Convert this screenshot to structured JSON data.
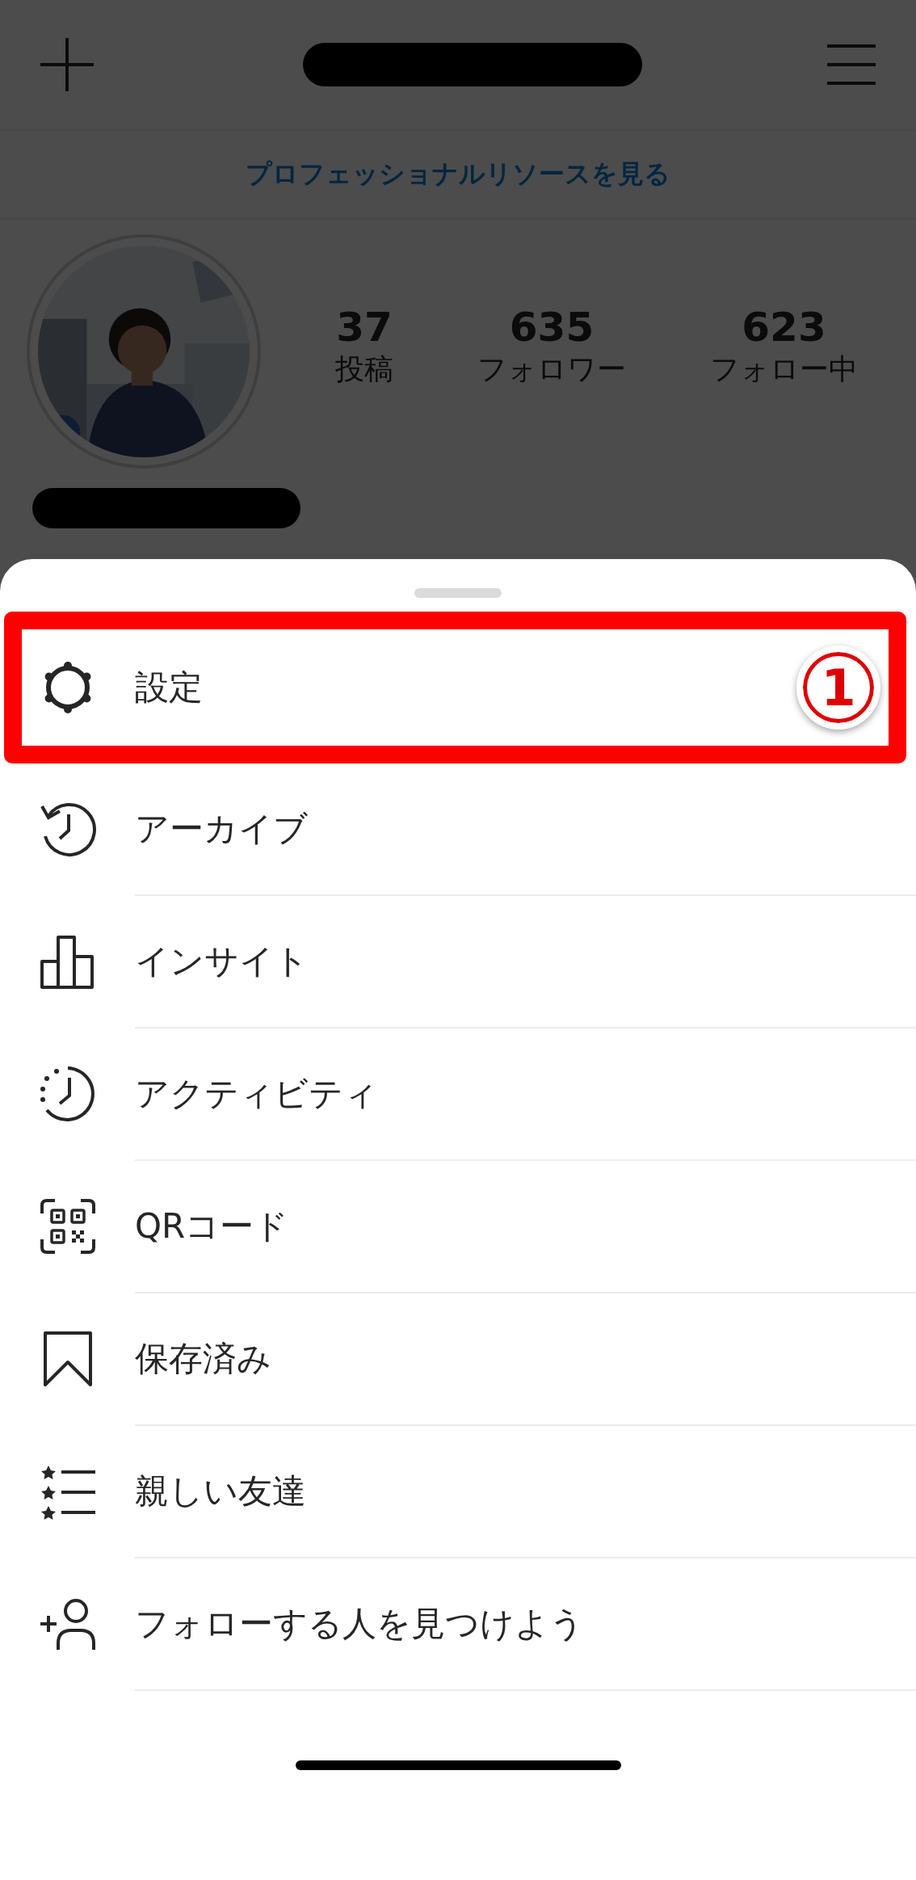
{
  "banner": {
    "link": "プロフェッショナルリソースを見る"
  },
  "profile": {
    "stats": [
      {
        "value": "37",
        "label": "投稿"
      },
      {
        "value": "635",
        "label": "フォロワー"
      },
      {
        "value": "623",
        "label": "フォロー中"
      }
    ]
  },
  "menu": {
    "items": [
      {
        "kind": "gear",
        "label": "設定",
        "highlighted": true,
        "callout": "1"
      },
      {
        "kind": "history",
        "label": "アーカイブ",
        "highlighted": false
      },
      {
        "kind": "chart",
        "label": "インサイト",
        "highlighted": false
      },
      {
        "kind": "activity",
        "label": "アクティビティ",
        "highlighted": false
      },
      {
        "kind": "qr",
        "label": "QRコード",
        "highlighted": false
      },
      {
        "kind": "bookmark",
        "label": "保存済み",
        "highlighted": false
      },
      {
        "kind": "stars",
        "label": "親しい友達",
        "highlighted": false
      },
      {
        "kind": "adduser",
        "label": "フォローする人を見つけよう",
        "highlighted": false
      }
    ]
  }
}
